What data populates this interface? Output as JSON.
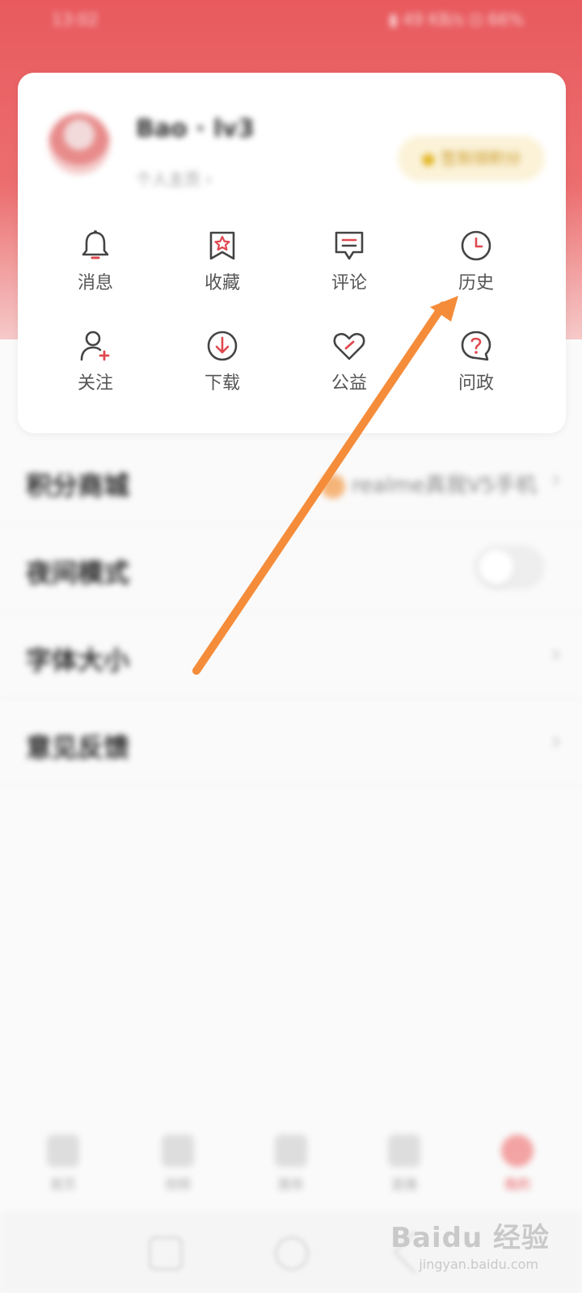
{
  "status_bar": {
    "time": "13:02",
    "right": "▮ 49 KB/s  ⊡ 66%"
  },
  "profile": {
    "username": "Bao · lv3",
    "homepage_link": "个人主页",
    "checkin_label": "签到领积分"
  },
  "grid": [
    {
      "label": "消息",
      "icon": "bell-icon"
    },
    {
      "label": "收藏",
      "icon": "bookmark-star-icon"
    },
    {
      "label": "评论",
      "icon": "comment-icon"
    },
    {
      "label": "历史",
      "icon": "clock-icon"
    },
    {
      "label": "关注",
      "icon": "user-add-icon"
    },
    {
      "label": "下载",
      "icon": "download-icon"
    },
    {
      "label": "公益",
      "icon": "heart-icon"
    },
    {
      "label": "问政",
      "icon": "question-bubble-icon"
    }
  ],
  "rows": {
    "points_mall": {
      "title": "积分商城",
      "right": "realme真我V5手机"
    },
    "night_mode": {
      "title": "夜间模式"
    },
    "font_size": {
      "title": "字体大小"
    },
    "feedback": {
      "title": "意见反馈"
    }
  },
  "nav": [
    {
      "label": "首页"
    },
    {
      "label": "视频"
    },
    {
      "label": "服务"
    },
    {
      "label": "直播"
    },
    {
      "label": "我的"
    }
  ],
  "watermark": {
    "main": "Baidu 经验",
    "sub": "jingyan.baidu.com"
  },
  "colors": {
    "header_red": "#e85a5e",
    "icon_accent": "#e0484f",
    "annotation_arrow": "#f58c3a"
  }
}
